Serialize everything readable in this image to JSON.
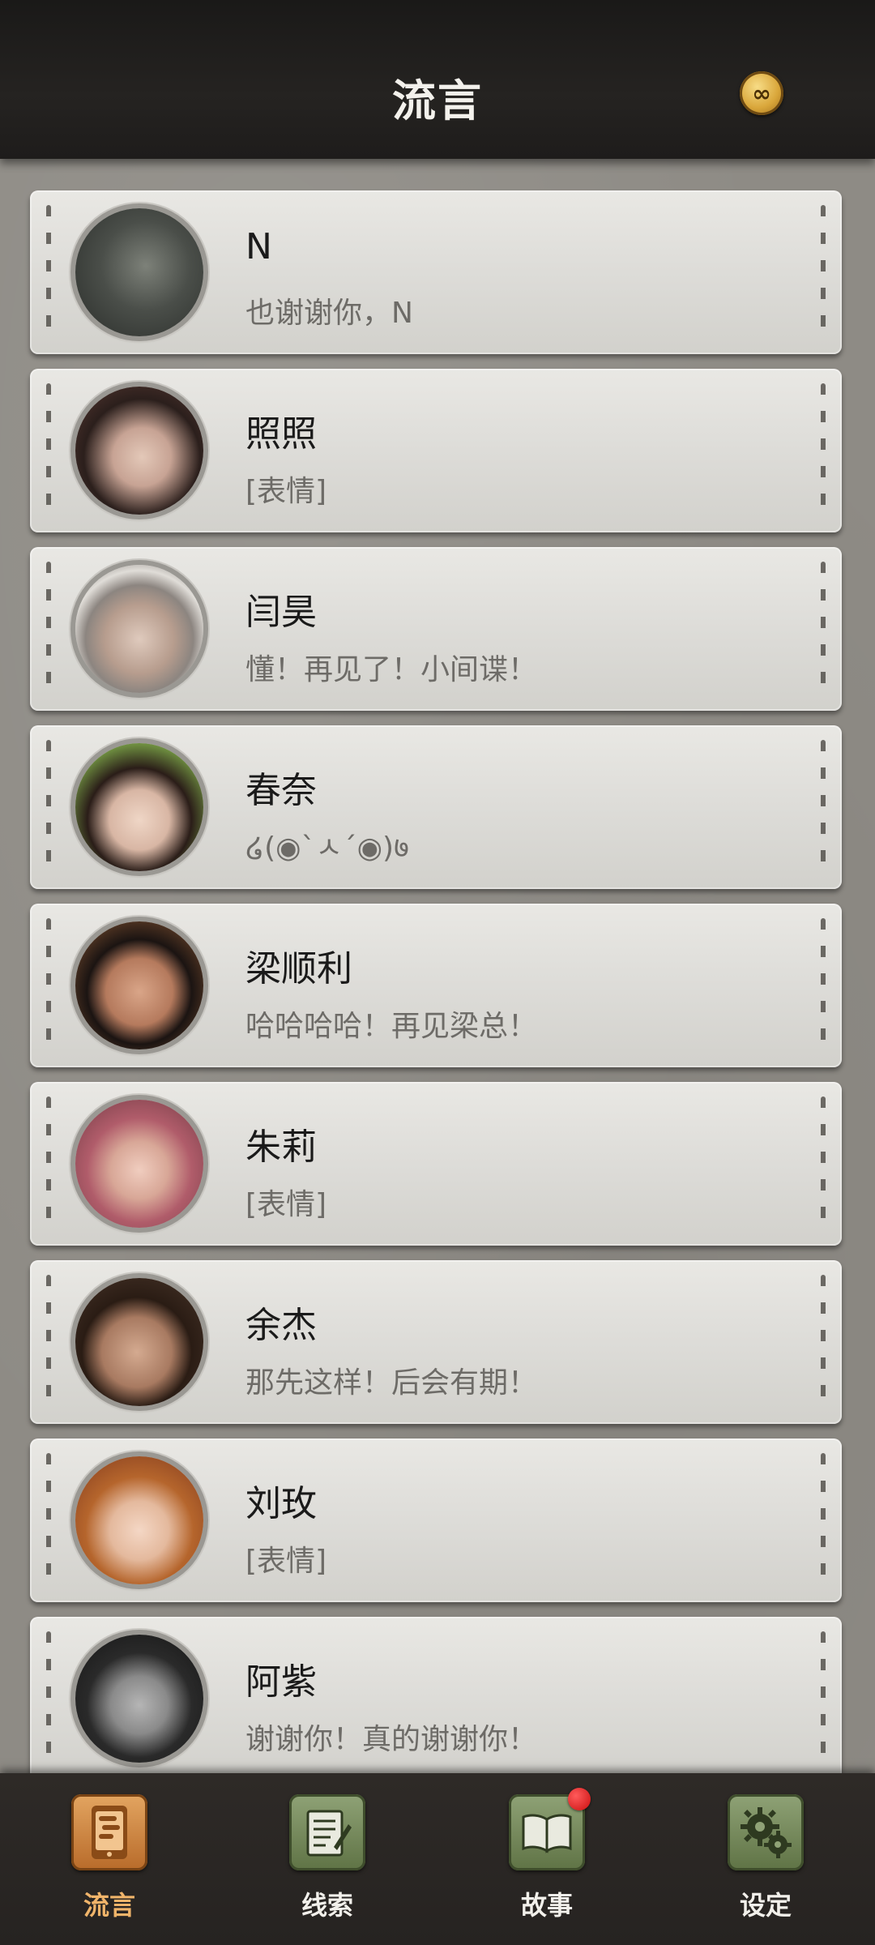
{
  "header": {
    "title": "流言",
    "coin_icon": "infinity-coin-icon",
    "coin_symbol": "∞"
  },
  "chats": [
    {
      "name": "N",
      "message": "也谢谢你，N",
      "avatar": "man-long-hair-avatar",
      "avatar_colors": [
        "#3a3f3a",
        "#7d8179"
      ]
    },
    {
      "name": "照照",
      "message": "[表情]",
      "avatar": "woman-dark-hair-avatar",
      "avatar_colors": [
        "#5b3a33",
        "#d6b8a8"
      ]
    },
    {
      "name": "闫昊",
      "message": "懂！再见了！小间谍！",
      "avatar": "man-silver-hair-avatar",
      "avatar_colors": [
        "#6a635e",
        "#d4c3b7"
      ]
    },
    {
      "name": "春奈",
      "message": "໒(◉`ㅅ´◉)७",
      "avatar": "woman-bangs-avatar",
      "avatar_colors": [
        "#6c8b3f",
        "#e7cdbd"
      ]
    },
    {
      "name": "梁顺利",
      "message": "哈哈哈哈！再见梁总！",
      "avatar": "middle-aged-man-avatar",
      "avatar_colors": [
        "#5a3a25",
        "#c89374"
      ]
    },
    {
      "name": "朱莉",
      "message": "[表情]",
      "avatar": "woman-pink-hair-avatar",
      "avatar_colors": [
        "#8d4a55",
        "#e9bfb2"
      ]
    },
    {
      "name": "余杰",
      "message": "那先这样！后会有期！",
      "avatar": "man-brown-hair-avatar",
      "avatar_colors": [
        "#3b2a20",
        "#c39b84"
      ]
    },
    {
      "name": "刘玫",
      "message": "[表情]",
      "avatar": "woman-auburn-hair-avatar",
      "avatar_colors": [
        "#9a4f25",
        "#efc9b1"
      ]
    },
    {
      "name": "阿紫",
      "message": "谢谢你！真的谢谢你！",
      "avatar": "man-monochrome-avatar",
      "avatar_colors": [
        "#1e1e1e",
        "#9a9a9a"
      ]
    }
  ],
  "nav": [
    {
      "label": "流言",
      "icon": "phone-chat-icon",
      "active": true
    },
    {
      "label": "线索",
      "icon": "notepad-icon",
      "active": false
    },
    {
      "label": "故事",
      "icon": "open-book-icon",
      "active": false,
      "badge": true
    },
    {
      "label": "设定",
      "icon": "gears-icon",
      "active": false
    }
  ],
  "colors": {
    "header_bg": "#1f1d1b",
    "card_bg": "#e2e1dd",
    "active_tab": "#f0b46a",
    "inactive_icon_bg": "#6f8354",
    "badge": "#d41616"
  }
}
